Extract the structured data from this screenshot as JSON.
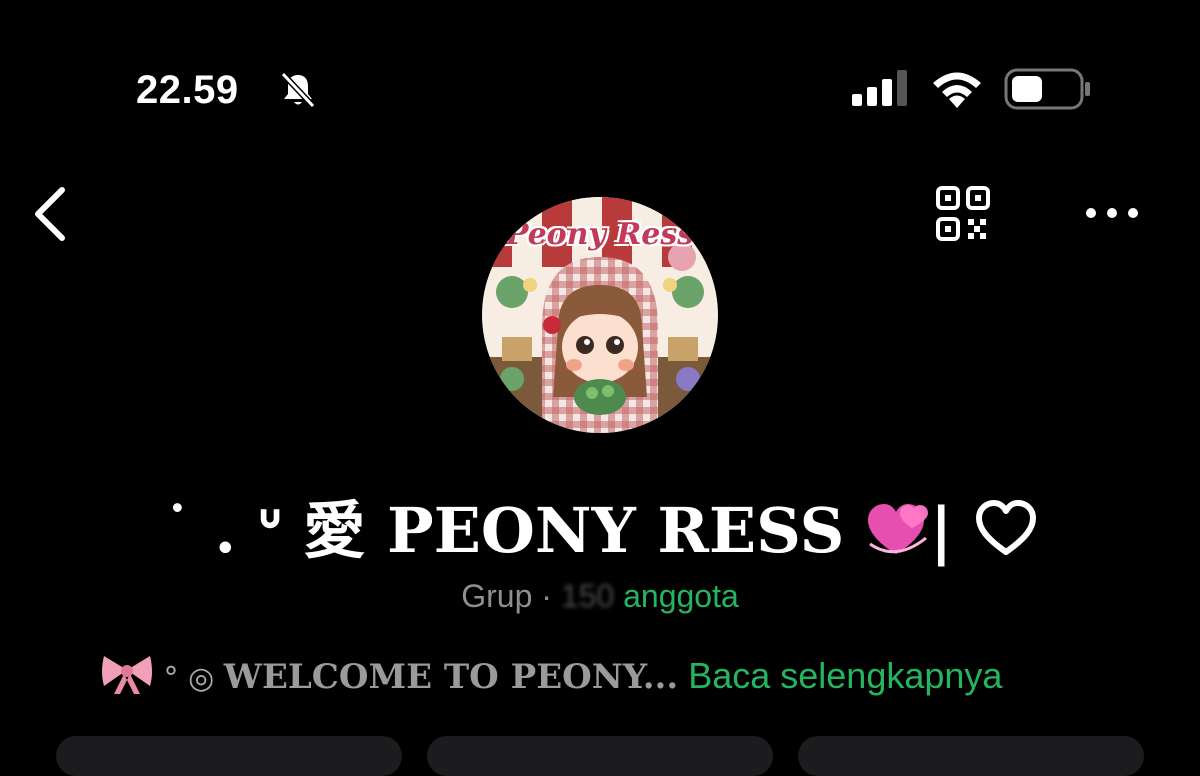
{
  "status_bar": {
    "time": "22.59",
    "icons": [
      "bell-slash-icon",
      "cellular-signal-icon",
      "wifi-icon",
      "battery-icon"
    ]
  },
  "nav": {
    "icons": [
      "back-chevron-icon",
      "qr-code-icon",
      "more-dots-icon"
    ]
  },
  "avatar": {
    "logo_text": "Peony Ress"
  },
  "group": {
    "name_prefix": "˙ . ᐡ 愛 PEONY RESS ",
    "name_suffix": "| ",
    "type": "Grup · ",
    "member_count": "150",
    "member_label": " anggota"
  },
  "description": {
    "decoration": " ° ◎ ",
    "text": "WELCOME TO PEONY...",
    "read_more": " Baca selengkapnya"
  },
  "colors": {
    "background": "#000000",
    "accent_green": "#25b561",
    "muted_text": "#8e8e93",
    "card_background": "#1c1c1e"
  }
}
